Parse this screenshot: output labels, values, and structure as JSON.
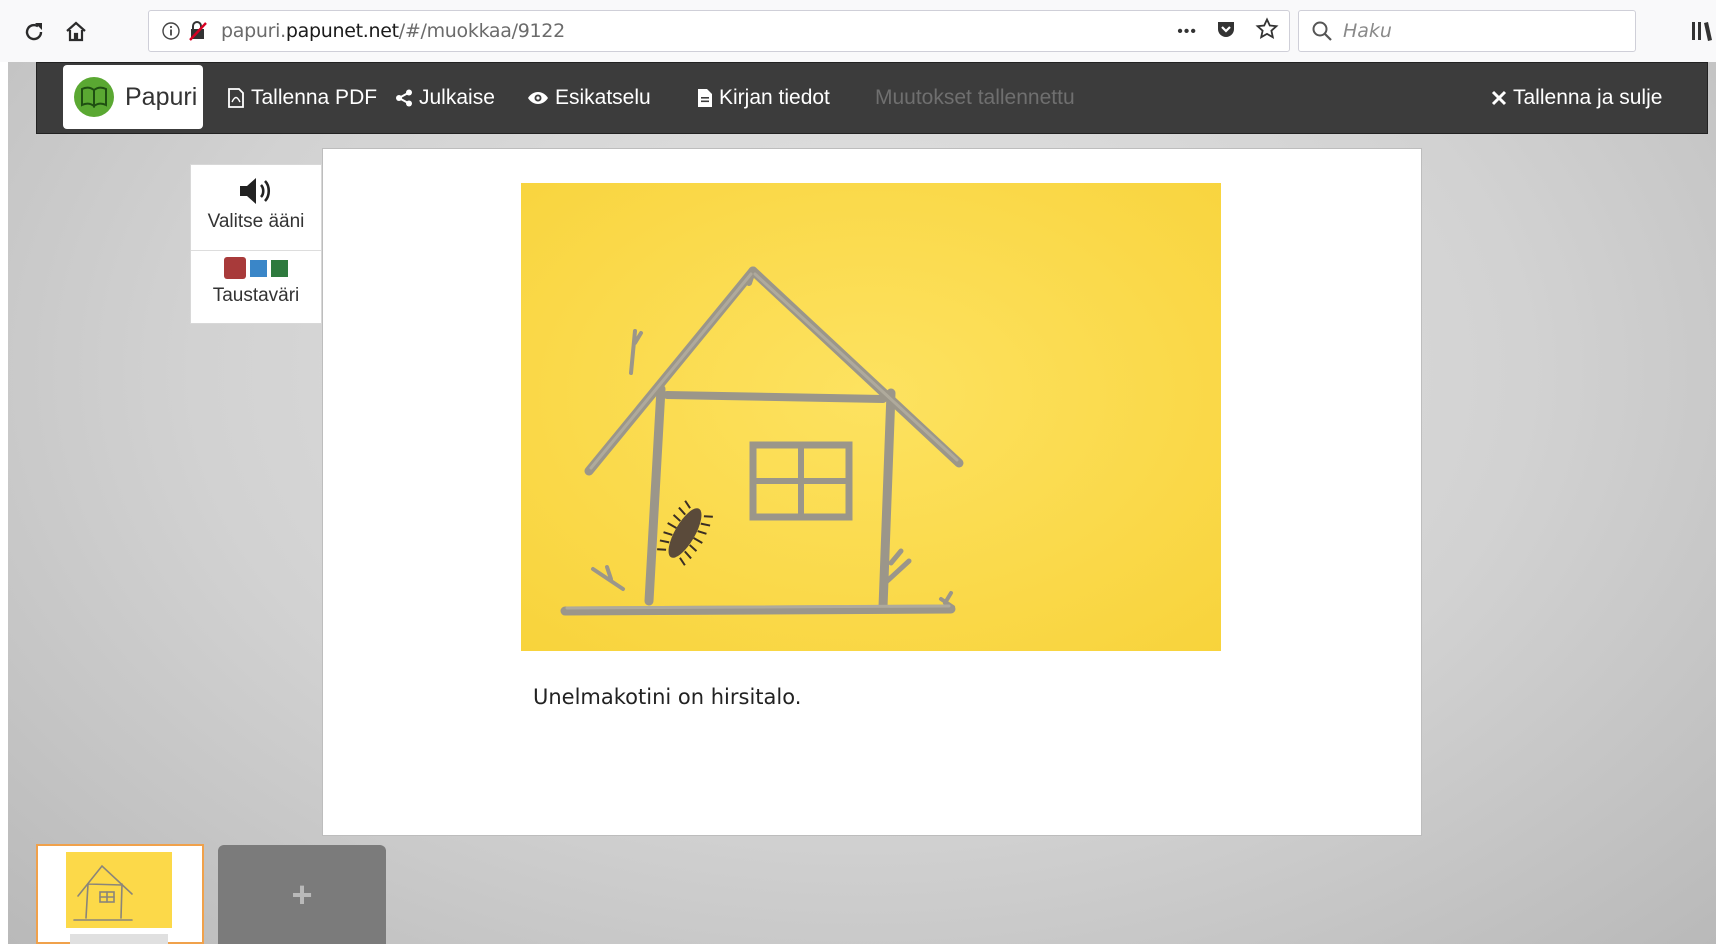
{
  "browser": {
    "url_prefix": "papuri.",
    "url_domain": "papunet.net",
    "url_path": "/#/muokkaa/9122",
    "search_placeholder": "Haku",
    "more_label": "•••"
  },
  "toolbar": {
    "brand": "Papuri",
    "save_pdf": "Tallenna PDF",
    "publish": "Julkaise",
    "preview": "Esikatselu",
    "book_info": "Kirjan tiedot",
    "status": "Muutokset tallennettu",
    "save_close": "Tallenna ja sulje"
  },
  "sidetools": {
    "sound_label": "Valitse ääni",
    "bg_label": "Taustaväri",
    "swatch_colors": [
      "#a83a3a",
      "#3a86c8",
      "#2e7a3e"
    ]
  },
  "page": {
    "caption": "Unelmakotini on hirsitalo."
  },
  "strip": {
    "add_label": "+"
  },
  "colors": {
    "toolbar_bg": "#3c3c3c",
    "photo_bg": "#fcd949",
    "active_thumb_border": "#f0a14b",
    "brand_green": "#5aa832"
  }
}
